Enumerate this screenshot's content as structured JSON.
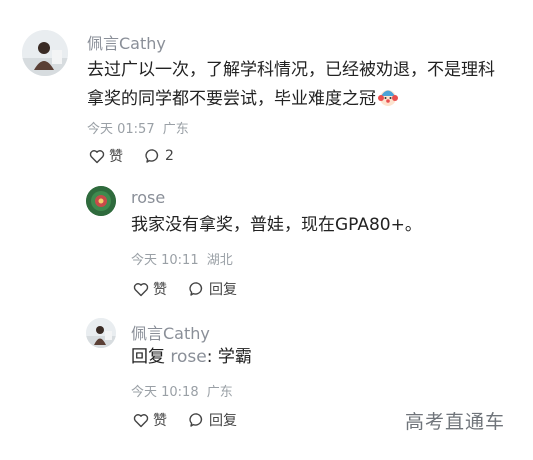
{
  "comments": [
    {
      "author": "佩言Cathy",
      "text_line1": "去过广以一次，了解学科情况，已经被劝退，不是理科",
      "text_line2": "拿奖的同学都不要尝试，毕业难度之冠",
      "emoji_icon": "clown-face-icon",
      "time": "今天 01:57",
      "location": "广东",
      "like_label": "赞",
      "comment_count": "2"
    }
  ],
  "replies": [
    {
      "author": "rose",
      "text": "我家没有拿奖，普娃，现在GPA80+。",
      "time": "今天 10:11",
      "location": "湖北",
      "like_label": "赞",
      "reply_label": "回复"
    },
    {
      "author": "佩言Cathy",
      "reply_prefix": "回复",
      "reply_to": "rose",
      "reply_text": ": 学霸",
      "time": "今天 10:18",
      "location": "广东",
      "like_label": "赞",
      "reply_label": "回复"
    }
  ],
  "watermark": "高考直通车",
  "colors": {
    "name": "#8a8f98",
    "meta": "#9aa0a6",
    "text": "#222222"
  }
}
